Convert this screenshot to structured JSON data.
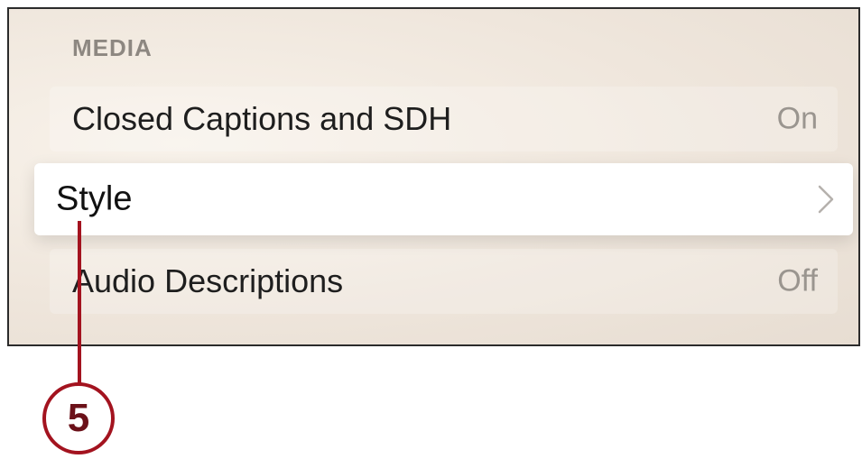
{
  "section": {
    "header": "MEDIA"
  },
  "rows": [
    {
      "label": "Closed Captions and SDH",
      "value": "On"
    },
    {
      "label": "Style",
      "value": "",
      "icon": "chevron-right-icon"
    },
    {
      "label": "Audio Descriptions",
      "value": "Off"
    }
  ],
  "callout": {
    "number": "5"
  },
  "colors": {
    "callout": "#a3131f",
    "background": "#efe6dc",
    "focused_row": "#ffffff"
  }
}
